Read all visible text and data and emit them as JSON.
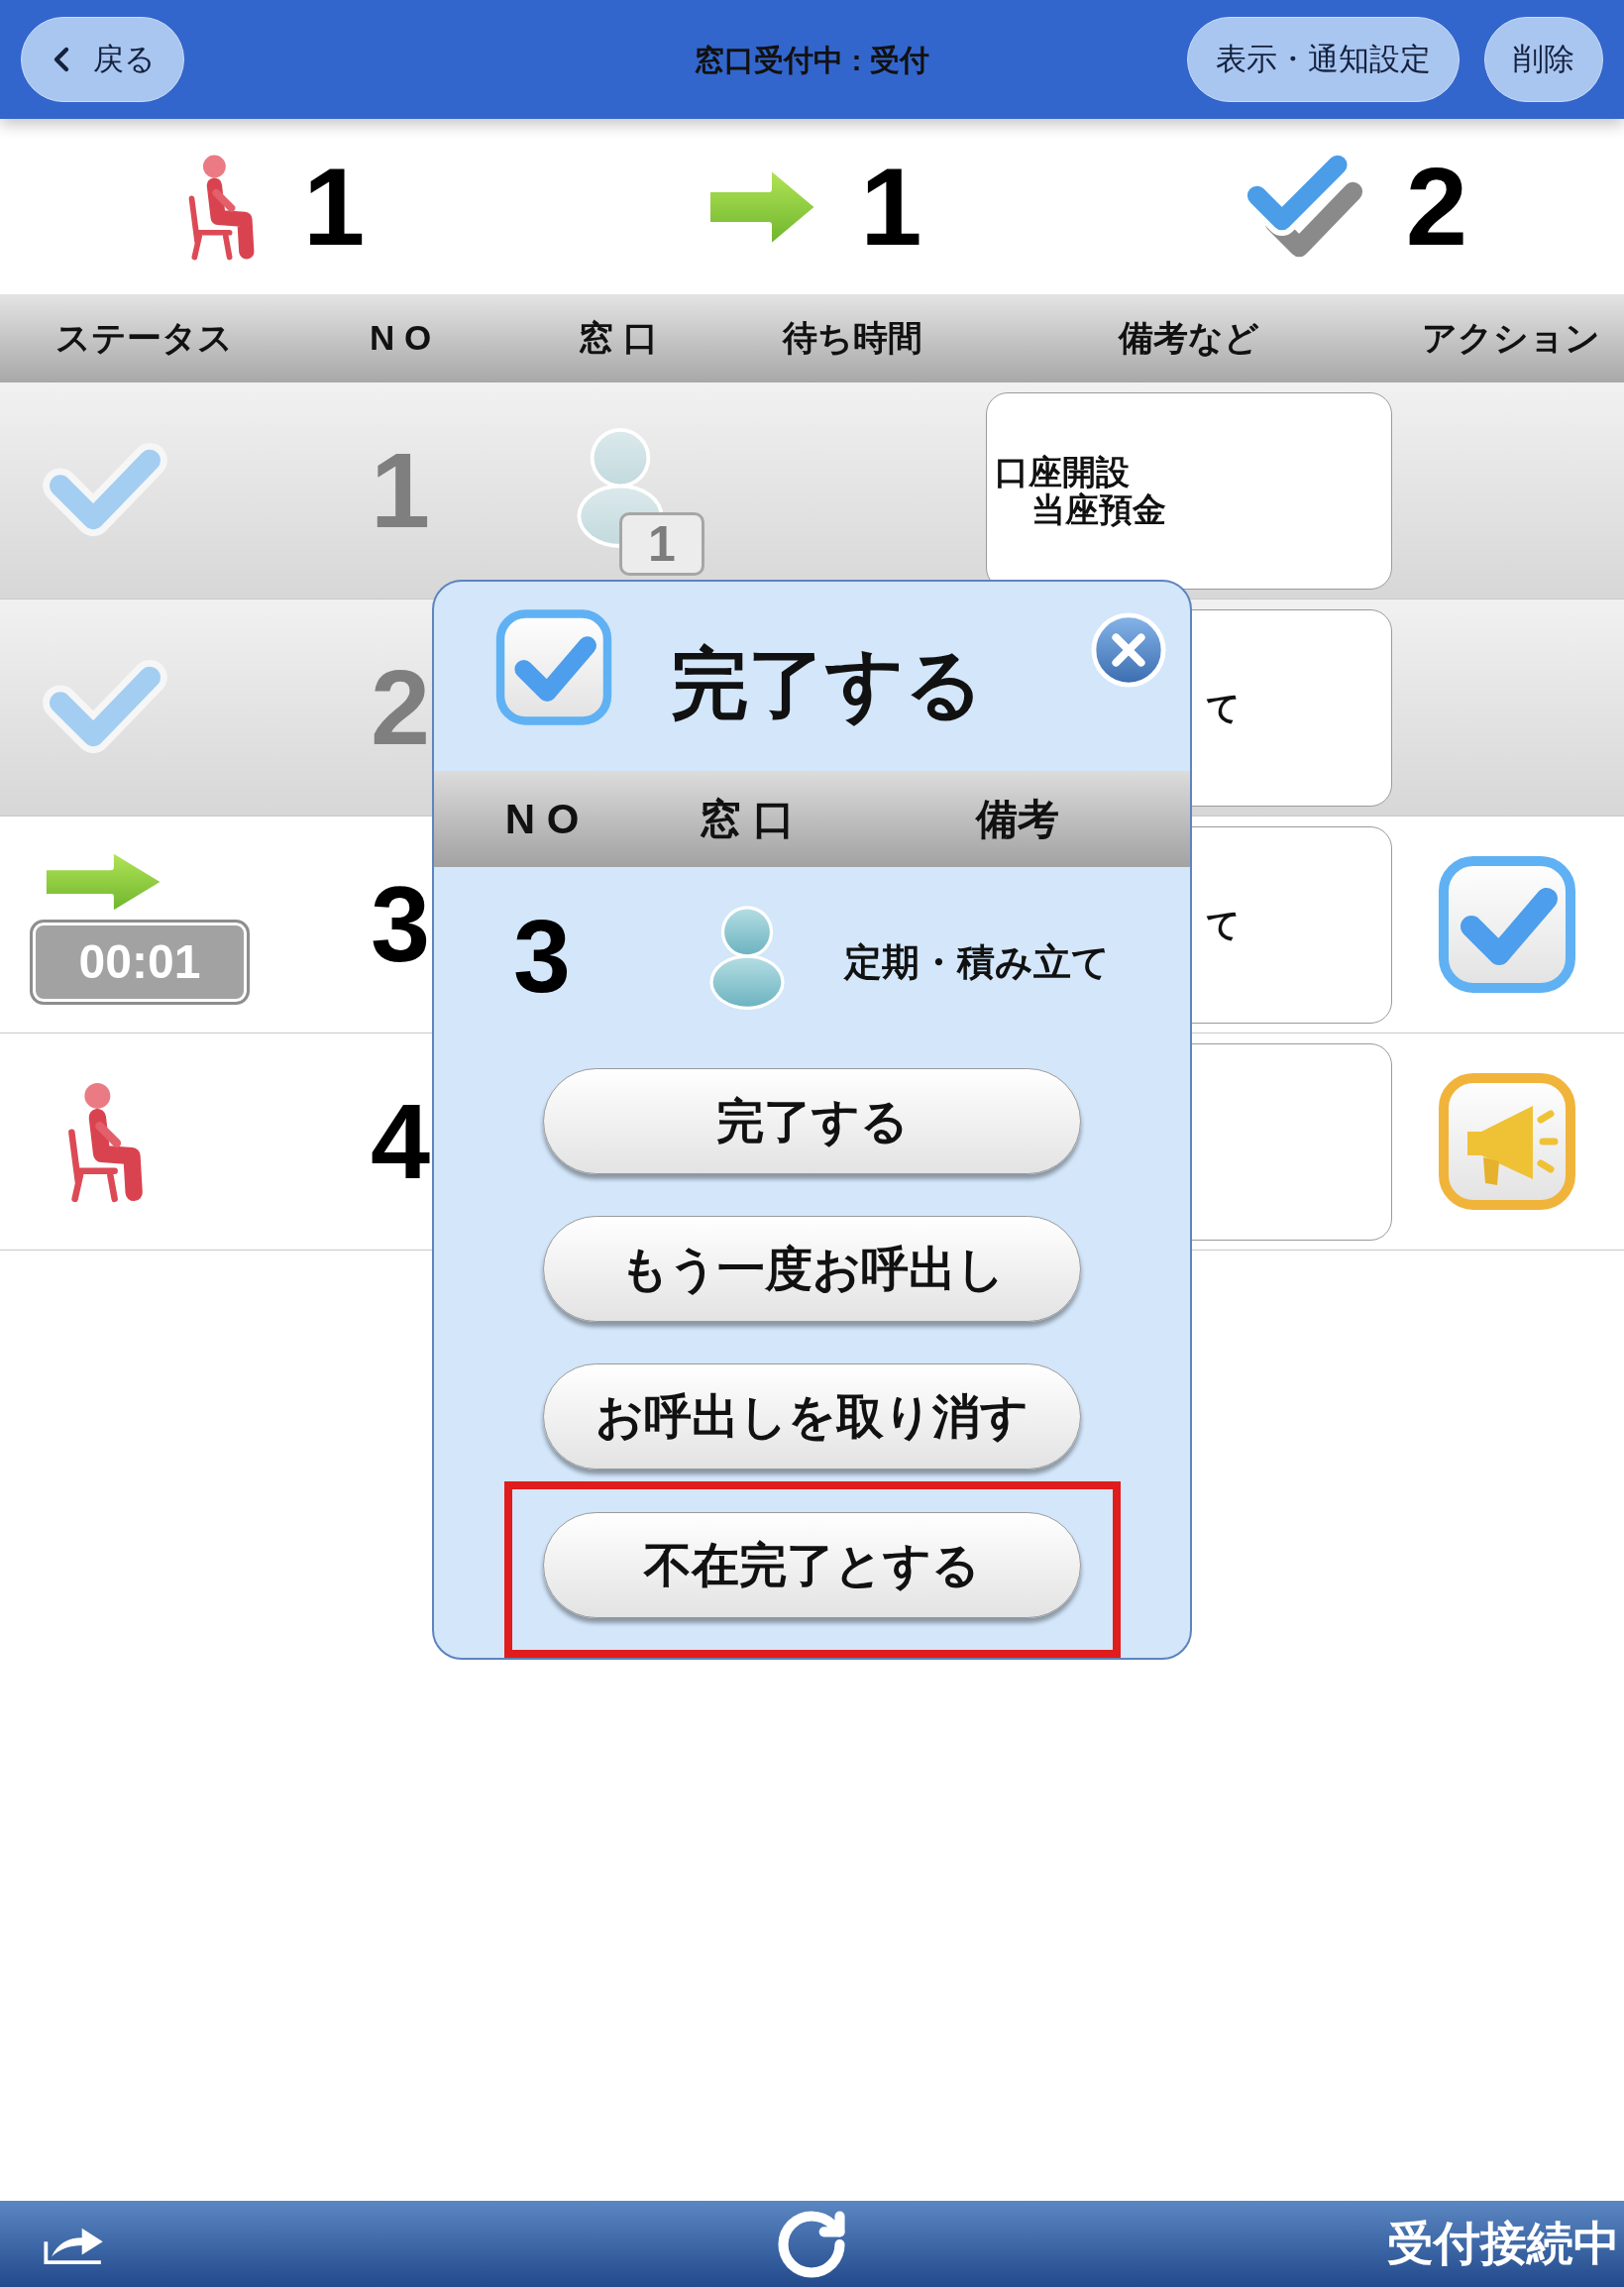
{
  "header": {
    "back": "戻る",
    "title": "窓口受付中 : 受付",
    "buttons": [
      "表示・通知設定",
      "削除"
    ]
  },
  "summary": [
    {
      "kind": "waiting",
      "count": "1"
    },
    {
      "kind": "calling",
      "count": "1"
    },
    {
      "kind": "done",
      "count": "2"
    }
  ],
  "table": {
    "columns": [
      "ステータス",
      "N O",
      "窓 口",
      "待ち時間",
      "備考など",
      "アクション"
    ],
    "rows": [
      {
        "kind": "done",
        "no": "1",
        "window": "1",
        "memo": {
          "lines": [
            "口座開設",
            "当座預金"
          ],
          "covered": false
        }
      },
      {
        "kind": "done",
        "no": "2",
        "memo": {
          "lines": [
            "て"
          ],
          "covered": true
        }
      },
      {
        "kind": "calling",
        "timer": "00:01",
        "no": "3",
        "memo": {
          "lines": [
            "て"
          ],
          "covered": true
        },
        "action": {
          "kind": "complete"
        }
      },
      {
        "kind": "waiting",
        "no": "4",
        "action": {
          "kind": "call"
        }
      }
    ]
  },
  "dialog": {
    "title": "完了する",
    "columns": [
      "N O",
      "窓 口",
      "備考"
    ],
    "row": {
      "no": "3",
      "memo": "定期・積み立て"
    },
    "buttons": [
      {
        "label": "完了する",
        "highlighted": false
      },
      {
        "label": "もう一度お呼出し",
        "highlighted": false
      },
      {
        "label": "お呼出しを取り消す",
        "highlighted": false
      },
      {
        "label": "不在完了とする",
        "highlighted": true
      }
    ]
  },
  "status_bar": {
    "text": "受付接続中"
  }
}
